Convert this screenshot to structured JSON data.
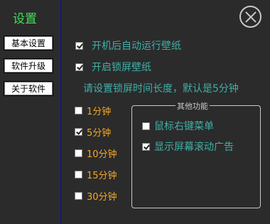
{
  "sidebar": {
    "title": "设置",
    "buttons": [
      {
        "label": "基本设置"
      },
      {
        "label": "软件升级"
      },
      {
        "label": "关于软件"
      }
    ]
  },
  "main": {
    "auto_start": {
      "label": "开机后自动运行壁纸",
      "checked": true
    },
    "lock_screen": {
      "label": "开启锁屏壁纸",
      "checked": true
    },
    "hint": "请设置锁屏时间长度，默认是5分钟",
    "durations": [
      {
        "label": "1分钟",
        "checked": false
      },
      {
        "label": "5分钟",
        "checked": true
      },
      {
        "label": "10分钟",
        "checked": false
      },
      {
        "label": "15分钟",
        "checked": false
      },
      {
        "label": "30分钟",
        "checked": false
      }
    ],
    "other": {
      "title": "其他功能",
      "items": [
        {
          "label": "鼠标右键菜单",
          "checked": false
        },
        {
          "label": "显示屏幕滚动广告",
          "checked": true
        }
      ]
    }
  },
  "colors": {
    "accent_green": "#3fe05a",
    "teal_text": "#3fb0a8",
    "orange_text": "#f5a623",
    "divider": "#101a80"
  },
  "icons": {
    "close": "close-circle-icon"
  }
}
